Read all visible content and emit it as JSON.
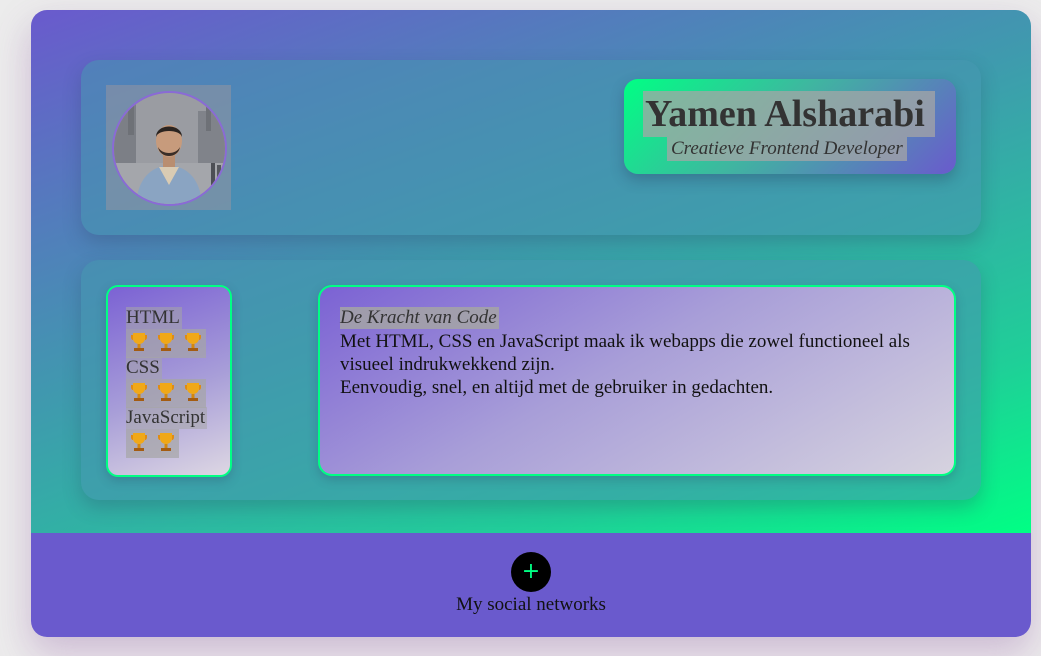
{
  "header": {
    "name": "Yamen Alsharabi",
    "subtitle": "Creatieve Frontend Developer",
    "avatar_icon": "profile-photo"
  },
  "skills": [
    {
      "label": "HTML",
      "trophies": 3
    },
    {
      "label": "CSS",
      "trophies": 3
    },
    {
      "label": "JavaScript",
      "trophies": 2
    }
  ],
  "intro": {
    "title": "De Kracht van Code",
    "paragraph1": "Met HTML, CSS en JavaScript maak ik webapps die zowel functioneel als visueel indrukwekkend zijn.",
    "paragraph2": "Eenvoudig, snel, en altijd met de gebruiker in gedachten."
  },
  "footer": {
    "plus_symbol": "+",
    "social_label": "My social networks"
  },
  "colors": {
    "accent_green": "#00ff84",
    "accent_purple": "#6a5acd"
  }
}
